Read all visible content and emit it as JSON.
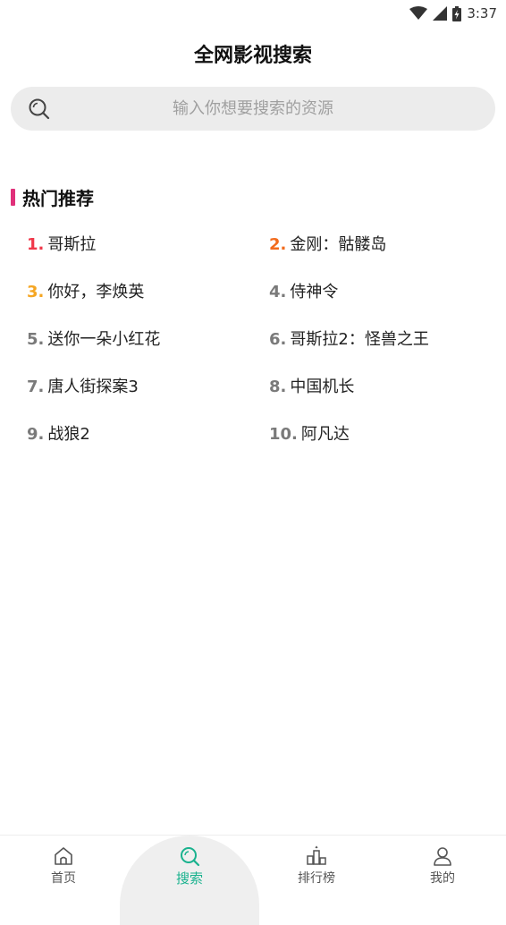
{
  "status_bar": {
    "time": "3:37",
    "icons": [
      "wifi-icon",
      "cell-signal-icon",
      "battery-icon"
    ]
  },
  "header": {
    "title": "全网影视搜索"
  },
  "search": {
    "placeholder": "输入你想要搜索的资源",
    "value": "",
    "icon": "search-icon"
  },
  "hot_section": {
    "title": "热门推荐",
    "accent_color": "#e0307a",
    "items": [
      {
        "rank": "1.",
        "title": "哥斯拉",
        "rank_color": "#f0384a"
      },
      {
        "rank": "2.",
        "title": "金刚：骷髅岛",
        "rank_color": "#f26b1d"
      },
      {
        "rank": "3.",
        "title": "你好，李焕英",
        "rank_color": "#f5a623"
      },
      {
        "rank": "4.",
        "title": "侍神令",
        "rank_color": "#7a7a7a"
      },
      {
        "rank": "5.",
        "title": "送你一朵小红花",
        "rank_color": "#7a7a7a"
      },
      {
        "rank": "6.",
        "title": "哥斯拉2：怪兽之王",
        "rank_color": "#7a7a7a"
      },
      {
        "rank": "7.",
        "title": "唐人街探案3",
        "rank_color": "#7a7a7a"
      },
      {
        "rank": "8.",
        "title": "中国机长",
        "rank_color": "#7a7a7a"
      },
      {
        "rank": "9.",
        "title": "战狼2",
        "rank_color": "#7a7a7a"
      },
      {
        "rank": "10.",
        "title": "阿凡达",
        "rank_color": "#7a7a7a"
      }
    ]
  },
  "bottom_nav": {
    "active_color": "#19b28e",
    "items": [
      {
        "label": "首页",
        "icon": "home-icon",
        "active": false
      },
      {
        "label": "搜索",
        "icon": "search-icon",
        "active": true
      },
      {
        "label": "排行榜",
        "icon": "ranking-icon",
        "active": false
      },
      {
        "label": "我的",
        "icon": "profile-icon",
        "active": false
      }
    ]
  }
}
